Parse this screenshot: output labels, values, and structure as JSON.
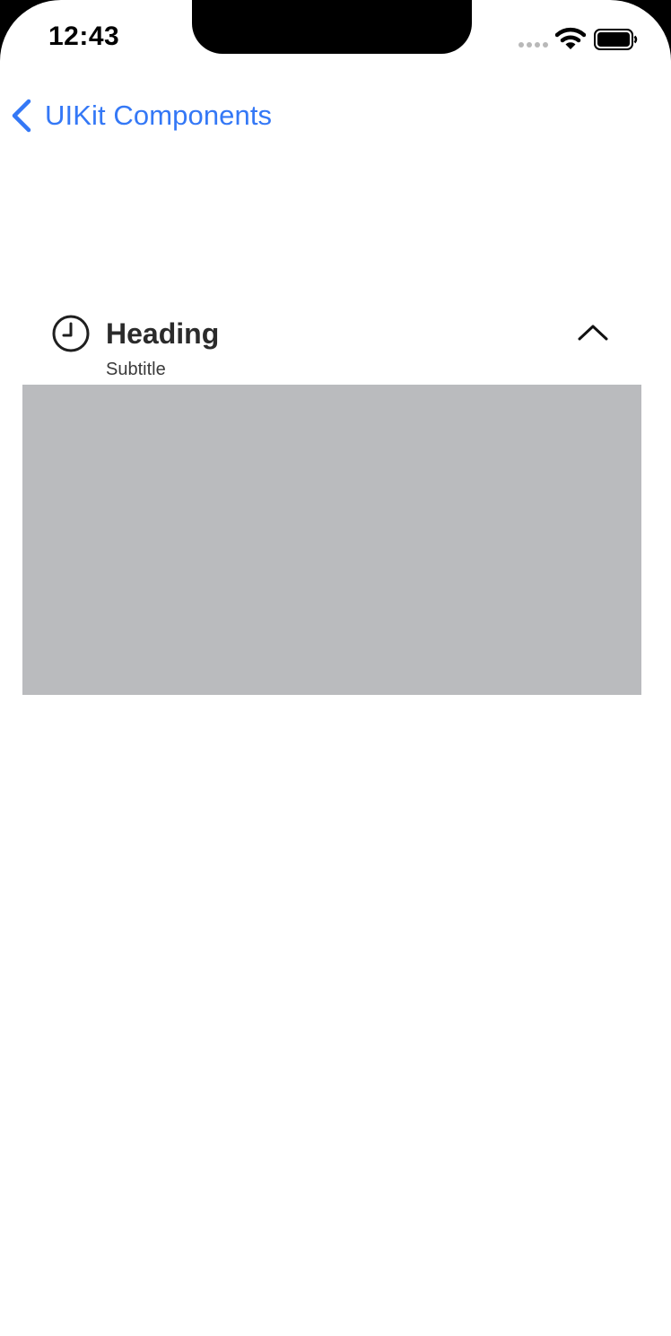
{
  "status_bar": {
    "time": "12:43",
    "icons": [
      "cellular-signal-icon",
      "wifi-icon",
      "battery-icon"
    ]
  },
  "nav": {
    "back_label": "UIKit Components",
    "back_icon": "chevron-left-icon"
  },
  "accordion": {
    "heading": "Heading",
    "subtitle": "Subtitle",
    "leading_icon": "clock-icon",
    "trailing_icon": "chevron-up-icon",
    "expanded": true
  },
  "colors": {
    "accent": "#3478f6",
    "content_placeholder": "#babbbe",
    "background": "#ffffff"
  }
}
